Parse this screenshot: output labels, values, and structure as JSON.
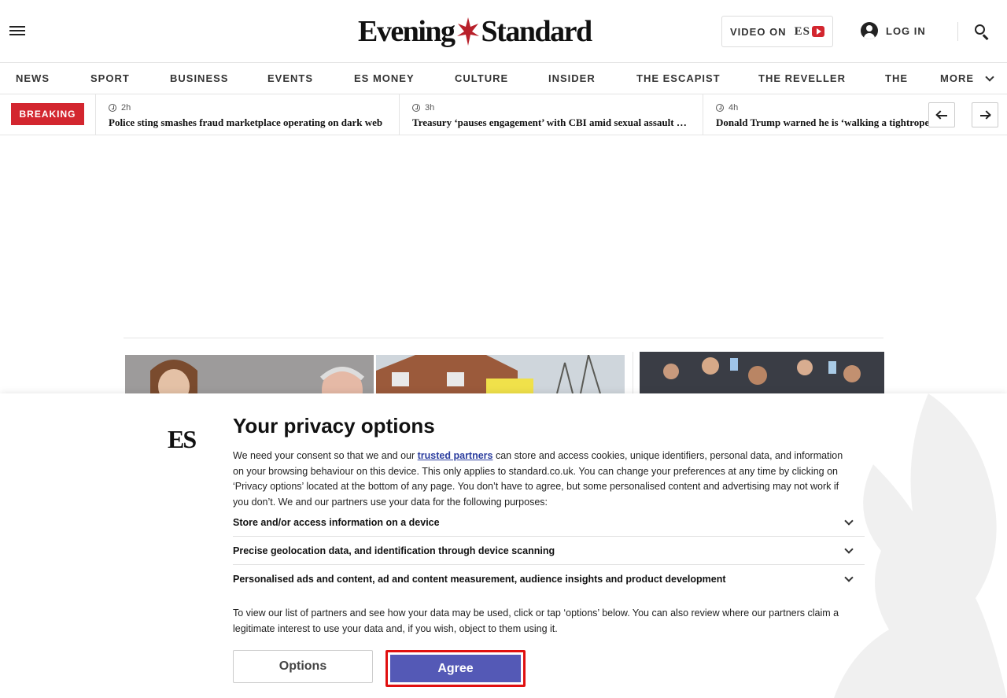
{
  "header": {
    "logo_text_left": "Evening",
    "logo_text_right": "Standard",
    "video_label": "VIDEO ON",
    "video_brand": "ES",
    "login_label": "LOG IN"
  },
  "nav": {
    "items": [
      "NEWS",
      "SPORT",
      "BUSINESS",
      "EVENTS",
      "ES MONEY",
      "CULTURE",
      "INSIDER",
      "THE ESCAPIST",
      "THE REVELLER",
      "THE"
    ],
    "more_label": "MORE"
  },
  "breaking": {
    "tag": "BREAKING",
    "items": [
      {
        "time": "2h",
        "title": "Police sting smashes fraud marketplace operating on dark web"
      },
      {
        "time": "3h",
        "title": "Treasury ‘pauses engagement’ with CBI amid sexual assault claims"
      },
      {
        "time": "4h",
        "title": "Donald Trump warned he is ‘walking a tightrope’ over"
      }
    ]
  },
  "privacy": {
    "logo": "ES",
    "title": "Your privacy options",
    "body_before_link": "We need your consent so that we and our ",
    "link_text": "trusted partners",
    "body_after_link": " can store and access cookies, unique identifiers, personal data, and information on your browsing behaviour on this device. This only applies to standard.co.uk. You can change your preferences at any time by clicking on ‘Privacy options’ located at the bottom of any page. You don’t have to agree, but some personalised content and advertising may not work if you don’t. We and our partners use your data for the following purposes:",
    "purposes": [
      "Store and/or access information on a device",
      "Precise geolocation data, and identification through device scanning",
      "Personalised ads and content, ad and content measurement, audience insights and product development"
    ],
    "note": "To view our list of partners and see how your data may be used, click or tap ‘options’ below. You can also review where our partners claim a legitimate interest to use your data and, if you wish, object to them using it.",
    "options_label": "Options",
    "agree_label": "Agree"
  },
  "colors": {
    "breaking_red": "#d3262f",
    "agree_button": "#5459b6",
    "link": "#2c3e9f",
    "highlight_outline": "#e01010"
  }
}
